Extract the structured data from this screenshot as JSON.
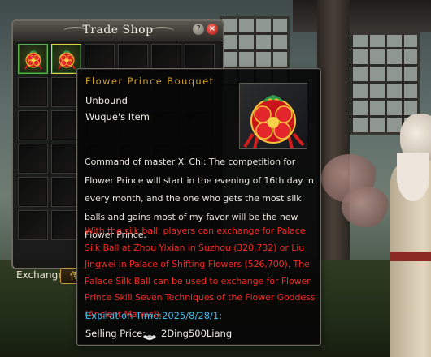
{
  "shop": {
    "title": "Trade Shop",
    "help_icon": "help-icon",
    "close_icon": "close-icon",
    "slots": [
      {
        "index": 0,
        "item": "flower-prince-bouquet-icon",
        "selected": false
      },
      {
        "index": 1,
        "item": "flower-prince-bouquet-icon",
        "selected": true
      }
    ],
    "rows": 6,
    "cols": 6
  },
  "footer": {
    "exchange_label": "Exchange",
    "tab_label": "传"
  },
  "tooltip": {
    "name": "Flower Prince Bouquet",
    "bind_status": "Unbound",
    "owner": "Wuque's Item",
    "description": "Command of master Xi Chi: The competition for Flower Prince will start in the evening of 16th day in every month, and the one who gets the most silk balls and gains most of my favor will be the new Flower Prince.",
    "usage": "With the silk ball, players can exchange for Palace Silk Ball at Zhou Yixian in Suzhou (320,732) or Liu Jingwei in Palace of Shifting Flowers (526,700). The Palace Silk Ball can be used to exchange for Flower Prince Skill Seven Techniques of the Flower Goddess (Ancient Manual).",
    "expiration": "Expiration Time:2025/8/28/1:",
    "price_label": "Selling Price:",
    "price_value": "2Ding500Liang",
    "price_icon": "silver-ingot-icon"
  },
  "colors": {
    "item_name": "#d4a02a",
    "usage_text": "#f22a22",
    "expiration_text": "#43b8e6",
    "slot_border_item": "#56b545"
  }
}
